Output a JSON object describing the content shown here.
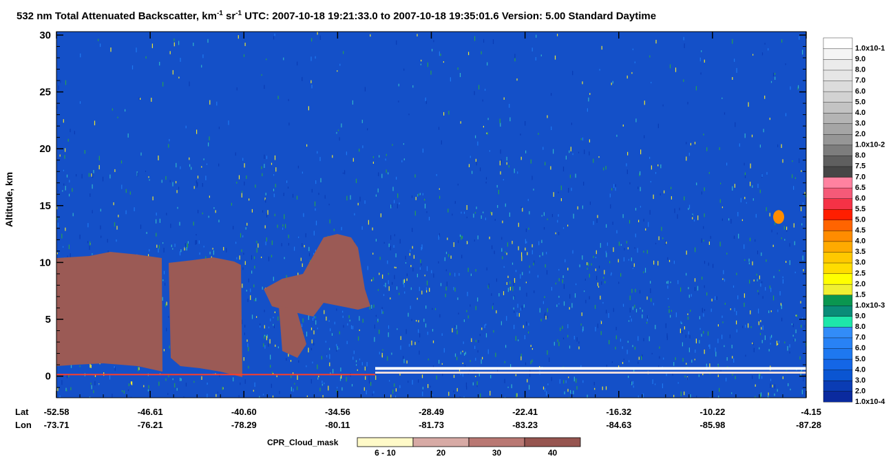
{
  "title": {
    "main": "532 nm Total Attenuated Backscatter, km",
    "sup1": "-1",
    "mid": " sr",
    "sup2": "-1",
    "tail": "    UTC:  2007-10-18 19:21:33.0  to  2007-10-18 19:35:01.6    Version: 5.00  Standard  Daytime"
  },
  "chart_data": {
    "type": "heatmap",
    "ylabel": "Altitude, km",
    "ylim": [
      -1.9,
      30.3
    ],
    "yticks": [
      0,
      5,
      10,
      15,
      20,
      25,
      30
    ],
    "x_row_labels": [
      "Lat",
      "Lon"
    ],
    "lat_ticks": [
      "-52.58",
      "-46.61",
      "-40.60",
      "-34.56",
      "-28.49",
      "-22.41",
      "-16.32",
      "-10.22",
      "-4.15"
    ],
    "lon_ticks": [
      "-73.71",
      "-76.21",
      "-78.29",
      "-80.11",
      "-81.73",
      "-83.23",
      "-84.63",
      "-85.98",
      "-87.28"
    ],
    "colorbar": {
      "labels": [
        "1.0x10-4",
        "2.0",
        "3.0",
        "4.0",
        "5.0",
        "6.0",
        "7.0",
        "8.0",
        "9.0",
        "1.0x10-3",
        "1.5",
        "2.0",
        "2.5",
        "3.0",
        "3.5",
        "4.0",
        "4.5",
        "5.0",
        "5.5",
        "6.0",
        "6.5",
        "7.0",
        "7.5",
        "8.0",
        "1.0x10-2",
        "2.0",
        "3.0",
        "4.0",
        "5.0",
        "6.0",
        "7.0",
        "8.0",
        "9.0",
        "1.0x10-1"
      ],
      "colors": [
        "#0a2a9e",
        "#0a3cb4",
        "#0a55d2",
        "#1466e6",
        "#1e78f0",
        "#2882f5",
        "#328cf8",
        "#1ee6aa",
        "#0a8c78",
        "#0a9650",
        "#f0f032",
        "#ffff00",
        "#ffdc00",
        "#ffc800",
        "#ffaa00",
        "#ff8c00",
        "#ff6400",
        "#ff1e00",
        "#f53246",
        "#f55a78",
        "#ff82a0",
        "#464646",
        "#5f5f5f",
        "#7d7d7d",
        "#969696",
        "#a5a5a5",
        "#b4b4b4",
        "#c3c3c3",
        "#d2d2d2",
        "#dcdcdc",
        "#e6e6e6",
        "#ebebeb",
        "#f5f5f5",
        "#ffffff"
      ]
    },
    "cpr_cloud_mask": {
      "label": "CPR_Cloud_mask",
      "categories": [
        "6 - 10",
        "20",
        "30",
        "40"
      ],
      "colors": [
        "#fffac8",
        "#d7aaa5",
        "#b97873",
        "#965550"
      ]
    },
    "features": {
      "cloud_mask_fill": "#9b5a55",
      "background": "#1450c8",
      "noise": [
        "#1e78f0",
        "#32b4c8",
        "#f0e632",
        "#28a050",
        "#0a3cb4"
      ]
    }
  }
}
